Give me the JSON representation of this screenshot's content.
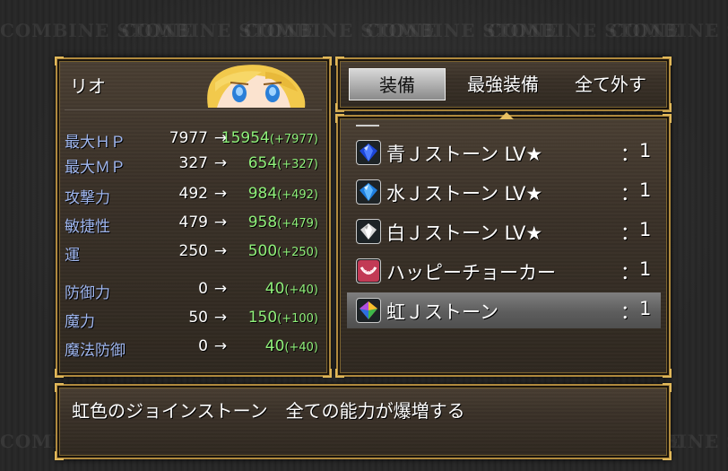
{
  "watermark": "COMBINE STONE",
  "character": {
    "name": "リオ"
  },
  "stats": [
    {
      "label": "最大ＨＰ",
      "current": "7977",
      "arrow": "→",
      "new": "15954",
      "bonus": "(+7977)"
    },
    {
      "label": "最大ＭＰ",
      "current": "327",
      "arrow": "→",
      "new": "654",
      "bonus": "(+327)"
    },
    {
      "label": "攻撃力",
      "current": "492",
      "arrow": "→",
      "new": "984",
      "bonus": "(+492)"
    },
    {
      "label": "敏捷性",
      "current": "479",
      "arrow": "→",
      "new": "958",
      "bonus": "(+479)"
    },
    {
      "label": "運",
      "current": "250",
      "arrow": "→",
      "new": "500",
      "bonus": "(+250)"
    },
    {
      "label": "防御力",
      "current": "0",
      "arrow": "→",
      "new": "40",
      "bonus": "(+40)"
    },
    {
      "label": "魔力",
      "current": "50",
      "arrow": "→",
      "new": "150",
      "bonus": "(+100)"
    },
    {
      "label": "魔法防御",
      "current": "0",
      "arrow": "→",
      "new": "40",
      "bonus": "(+40)"
    }
  ],
  "commands": [
    {
      "label": "装備",
      "selected": true
    },
    {
      "label": "最強装備",
      "selected": false
    },
    {
      "label": "全て外す",
      "selected": false
    }
  ],
  "items": [
    {
      "name": "青Ｊストーン LV★",
      "colon": "：",
      "qty": "1",
      "icon": "blue-gem-icon",
      "selected": false
    },
    {
      "name": "水Ｊストーン LV★",
      "colon": "：",
      "qty": "1",
      "icon": "water-gem-icon",
      "selected": false
    },
    {
      "name": "白Ｊストーン LV★",
      "colon": "：",
      "qty": "1",
      "icon": "white-gem-icon",
      "selected": false
    },
    {
      "name": "ハッピーチョーカー",
      "colon": "：",
      "qty": "1",
      "icon": "choker-icon",
      "selected": false
    },
    {
      "name": "虹Ｊストーン",
      "colon": "：",
      "qty": "1",
      "icon": "rainbow-gem-icon",
      "selected": true
    }
  ],
  "description": "虹色のジョインストーン　全ての能力が爆増する",
  "colors": {
    "stat_label": "#9fb6ef",
    "stat_new": "#8ff07a",
    "frame_gold": "#b08a3e"
  }
}
